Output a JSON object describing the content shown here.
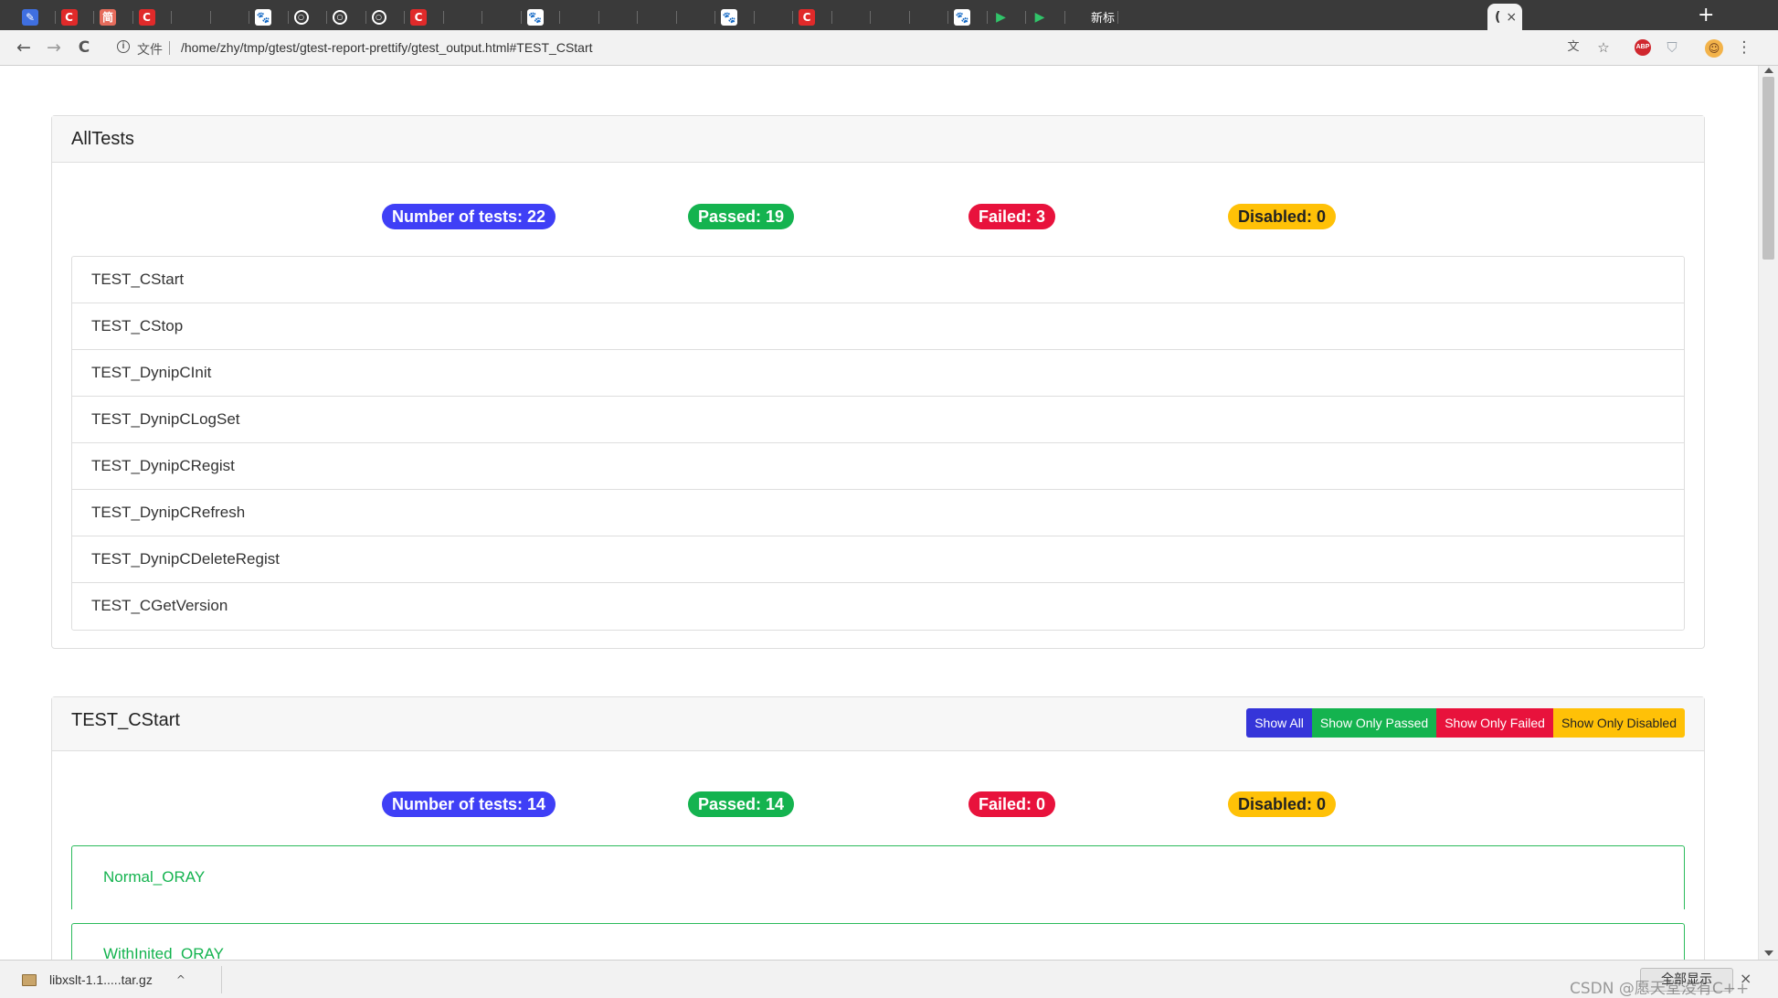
{
  "browser": {
    "tabs": [
      {
        "icon": "doc-icon",
        "glyph": "✎"
      },
      {
        "icon": "csdn-icon",
        "glyph": "C"
      },
      {
        "icon": "jianshu-icon",
        "glyph": "简"
      },
      {
        "icon": "csdn-icon",
        "glyph": "C"
      },
      {
        "icon": "blank-icon",
        "glyph": ""
      },
      {
        "icon": "blank-icon",
        "glyph": ""
      },
      {
        "icon": "baidu-icon",
        "glyph": "🐾"
      },
      {
        "icon": "github-icon",
        "glyph": "○"
      },
      {
        "icon": "github-icon",
        "glyph": "○"
      },
      {
        "icon": "github-icon",
        "glyph": "○"
      },
      {
        "icon": "csdn-icon",
        "glyph": "C"
      },
      {
        "icon": "blank-icon",
        "glyph": ""
      },
      {
        "icon": "blank-icon",
        "glyph": ""
      },
      {
        "icon": "baidu-icon",
        "glyph": "🐾"
      },
      {
        "icon": "blank-icon",
        "glyph": ""
      },
      {
        "icon": "blank-icon",
        "glyph": ""
      },
      {
        "icon": "blank-icon",
        "glyph": ""
      },
      {
        "icon": "blank-icon",
        "glyph": ""
      },
      {
        "icon": "baidu-icon",
        "glyph": "🐾"
      },
      {
        "icon": "blank-icon",
        "glyph": ""
      },
      {
        "icon": "csdn-icon",
        "glyph": "C"
      },
      {
        "icon": "blank-icon",
        "glyph": ""
      },
      {
        "icon": "blank-icon",
        "glyph": ""
      },
      {
        "icon": "blank-icon",
        "glyph": ""
      },
      {
        "icon": "baidu-icon",
        "glyph": "🐾"
      },
      {
        "icon": "play-icon",
        "glyph": "▶"
      },
      {
        "icon": "play-icon",
        "glyph": "▶"
      }
    ],
    "new_tab_label": "新标",
    "active_tab_glyph": "(",
    "active_tab_close": "×",
    "new_tab_plus": "+",
    "address": {
      "security_label": "文件",
      "url": "/home/zhy/tmp/gtest/gtest-report-prettify/gtest_output.html#TEST_CStart"
    },
    "toolbar_icons": {
      "back": "←",
      "forward": "→",
      "reload": "C",
      "translate": "文",
      "bookmark": "☆",
      "abp": "ABP",
      "shield": "⛉",
      "menu": "⋮"
    }
  },
  "summary": {
    "title": "AllTests",
    "badges": {
      "total": "Number of tests: 22",
      "passed": "Passed: 19",
      "failed": "Failed: 3",
      "disabled": "Disabled: 0"
    },
    "suites": [
      "TEST_CStart",
      "TEST_CStop",
      "TEST_DynipCInit",
      "TEST_DynipCLogSet",
      "TEST_DynipCRegist",
      "TEST_DynipCRefresh",
      "TEST_DynipCDeleteRegist",
      "TEST_CGetVersion"
    ]
  },
  "suite_detail": {
    "title": "TEST_CStart",
    "filters": {
      "show_all": "Show All",
      "only_passed": "Show Only Passed",
      "only_failed": "Show Only Failed",
      "only_disabled": "Show Only Disabled"
    },
    "badges": {
      "total": "Number of tests: 14",
      "passed": "Passed: 14",
      "failed": "Failed: 0",
      "disabled": "Disabled: 0"
    },
    "tests": [
      "Normal_ORAY",
      "WithInited_ORAY"
    ]
  },
  "download_bar": {
    "file_name": "libxslt-1.1.....tar.gz",
    "caret": "^",
    "show_all": "全部显示",
    "close": "×",
    "watermark": "CSDN @愿天堂没有C++"
  },
  "colors": {
    "blue": "#3f3ff6",
    "green": "#14b34f",
    "red": "#e8123c",
    "yellow": "#ffc107"
  }
}
